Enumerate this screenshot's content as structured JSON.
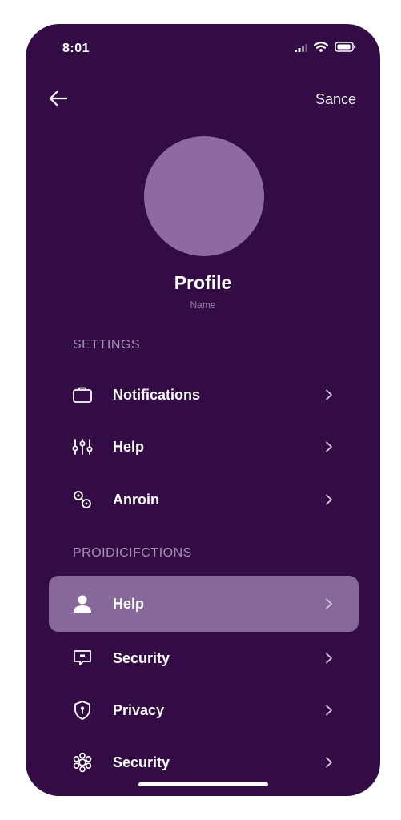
{
  "status_bar": {
    "time": "8:01",
    "icons": [
      "signal-icon",
      "wifi-icon",
      "battery-icon"
    ]
  },
  "header": {
    "back_icon": "arrow-left-icon",
    "action_label": "Sance"
  },
  "profile": {
    "title": "Profile",
    "subtitle": "Name"
  },
  "sections": [
    {
      "label": "SETTINGS",
      "items": [
        {
          "label": "Notifications",
          "icon": "briefcase-icon",
          "active": false
        },
        {
          "label": "Help",
          "icon": "sliders-icon",
          "active": false
        },
        {
          "label": "Anroin",
          "icon": "link-icon",
          "active": false
        }
      ]
    },
    {
      "label": "PROIDICIFCTIONS",
      "items": [
        {
          "label": "Help",
          "icon": "user-icon",
          "active": true
        },
        {
          "label": "Security",
          "icon": "message-icon",
          "active": false
        },
        {
          "label": "Privacy",
          "icon": "shield-icon",
          "active": false
        },
        {
          "label": "Security",
          "icon": "gear-icon",
          "active": false
        }
      ]
    }
  ],
  "colors": {
    "background": "#330c45",
    "avatar": "#8d6ba0",
    "active_row": "#86689a",
    "section_label": "#a690b6"
  }
}
